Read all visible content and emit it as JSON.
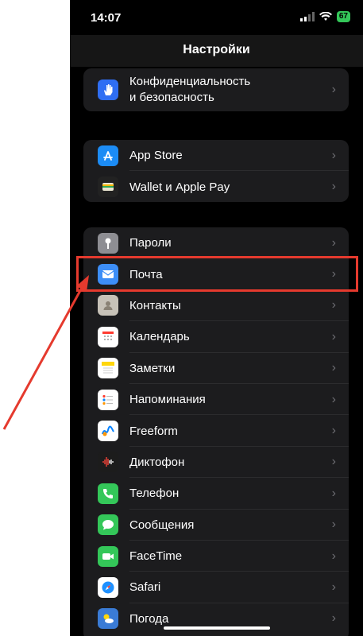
{
  "status": {
    "time": "14:07",
    "battery": "67"
  },
  "nav": {
    "title": "Настройки"
  },
  "groups": [
    {
      "items": [
        {
          "label_lines": [
            "Конфиденциальность",
            "и безопасность"
          ],
          "icon": "hand-icon",
          "color": "#2f6ef3"
        }
      ]
    },
    {
      "items": [
        {
          "label": "App Store",
          "icon": "app-store-icon",
          "color": "#1c8cf5"
        },
        {
          "label": "Wallet и Apple Pay",
          "icon": "wallet-icon",
          "color": "#222222"
        }
      ]
    },
    {
      "items": [
        {
          "label": "Пароли",
          "icon": "key-icon",
          "color": "#8e8e93"
        },
        {
          "label": "Почта",
          "icon": "mail-icon",
          "color": "#3d8ef7"
        },
        {
          "label": "Контакты",
          "icon": "contacts-icon",
          "color": "#c7c2b8"
        },
        {
          "label": "Календарь",
          "icon": "calendar-icon",
          "color": "#ffffff"
        },
        {
          "label": "Заметки",
          "icon": "notes-icon",
          "color": "#ffffff"
        },
        {
          "label": "Напоминания",
          "icon": "reminders-icon",
          "color": "#ffffff"
        },
        {
          "label": "Freeform",
          "icon": "freeform-icon",
          "color": "#ffffff"
        },
        {
          "label": "Диктофон",
          "icon": "voice-memo-icon",
          "color": "#1c1c1c"
        },
        {
          "label": "Телефон",
          "icon": "phone-icon",
          "color": "#34c759"
        },
        {
          "label": "Сообщения",
          "icon": "messages-icon",
          "color": "#34c759"
        },
        {
          "label": "FaceTime",
          "icon": "facetime-icon",
          "color": "#34c759"
        },
        {
          "label": "Safari",
          "icon": "safari-icon",
          "color": "#1e90ff"
        },
        {
          "label": "Погода",
          "icon": "weather-icon",
          "color": "#3a7bd5"
        }
      ]
    }
  ],
  "annotation": {
    "highlight_color": "#e53a2e"
  }
}
